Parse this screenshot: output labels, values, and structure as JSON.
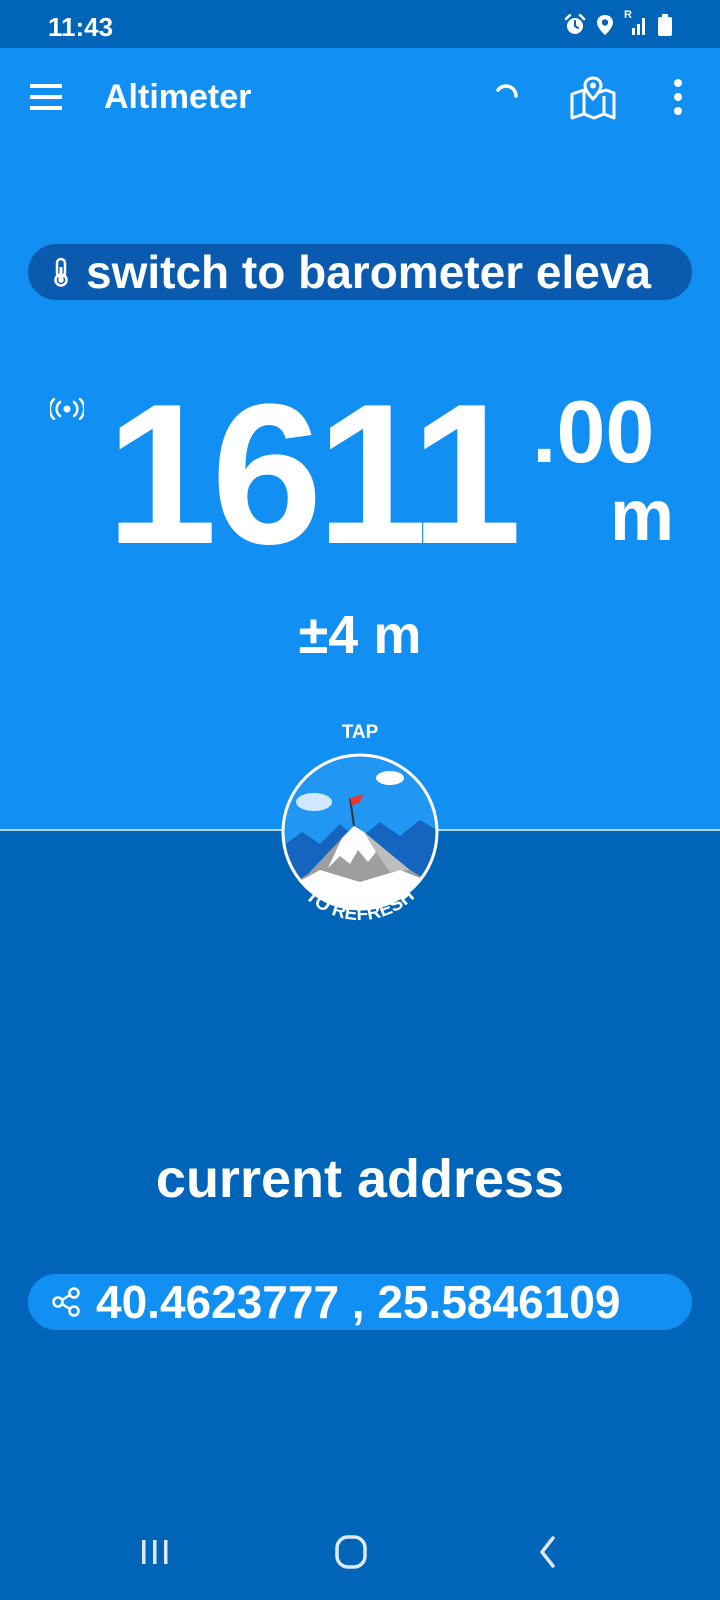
{
  "status_bar": {
    "time": "11:43",
    "icons": [
      "alarm-icon",
      "location-icon",
      "signal-icon",
      "battery-icon"
    ],
    "roaming_marker": "R"
  },
  "app_bar": {
    "title": "Altimeter",
    "icons": [
      "menu-icon",
      "refresh-icon",
      "map-icon",
      "more-icon"
    ]
  },
  "barometer_pill": {
    "icon": "thermometer-icon",
    "text": "switch to barometer eleva"
  },
  "elevation": {
    "integer": "1611",
    "decimal": ".00",
    "unit": "m",
    "accuracy": "±4 m",
    "signal_icon": "gps-signal-icon"
  },
  "tap_button": {
    "top_text": "TAP",
    "bottom_text": "TO REFRESH",
    "image": "mountain-peak-flag-icon"
  },
  "address": {
    "label": "current address",
    "coordinates": "40.4623777 , 25.5846109",
    "icon": "share-icon"
  },
  "nav_bar": {
    "icons": [
      "recent-apps-icon",
      "home-icon",
      "back-icon"
    ]
  },
  "colors": {
    "top_background": "#128ff3",
    "bottom_background": "#0065b8",
    "status_bar": "#0065b8",
    "pill_dark": "#0a5bb0",
    "text": "#ffffff"
  }
}
